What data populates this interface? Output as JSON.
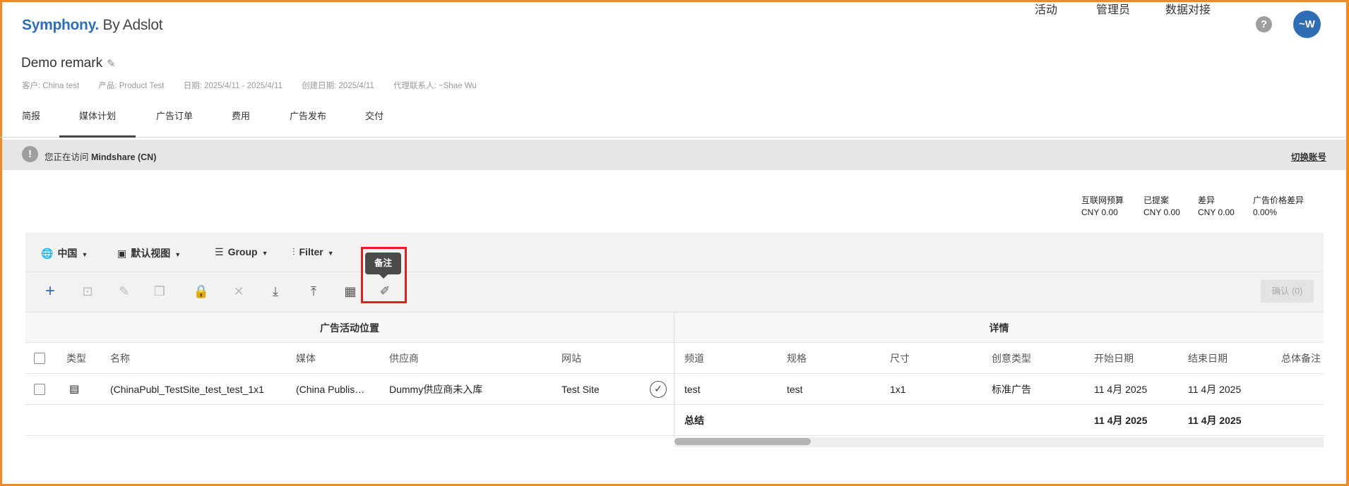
{
  "header": {
    "logo_brand": "Symphony.",
    "logo_suffix": "By Adslot",
    "nav": [
      "活动",
      "管理员",
      "数据对接"
    ],
    "help": "?",
    "avatar": "~W"
  },
  "campaign": {
    "title": "Demo remark",
    "meta": {
      "client": "客户: China test",
      "product": "产品: Product Test",
      "dates": "日期: 2025/4/11 - 2025/4/11",
      "created": "创建日期: 2025/4/11",
      "agency_contact": "代理联系人: ~Shae Wu"
    }
  },
  "tabs": [
    "简报",
    "媒体计划",
    "广告订单",
    "费用",
    "广告发布",
    "交付"
  ],
  "banner": {
    "prefix": "您正在访问",
    "account": "Mindshare (CN)",
    "switch_label": "切换账号"
  },
  "budget": [
    {
      "label": "互联网预算",
      "value": "CNY 0.00"
    },
    {
      "label": "已提案",
      "value": "CNY 0.00"
    },
    {
      "label": "差异",
      "value": "CNY 0.00"
    },
    {
      "label": "广告价格差异",
      "value": "0.00%"
    }
  ],
  "toolbar": {
    "country": "中国",
    "view": "默认视图",
    "group": "Group",
    "filter": "Filter",
    "tooltip": "备注",
    "confirm": "确认 (0)"
  },
  "table": {
    "group_left": "广告活动位置",
    "group_right": "详情",
    "columns": [
      "类型",
      "名称",
      "媒体",
      "供应商",
      "网站",
      "频道",
      "规格",
      "尺寸",
      "创意类型",
      "开始日期",
      "结束日期",
      "总体备注"
    ],
    "row": {
      "name": "(ChinaPubl_TestSite_test_test_1x1",
      "media": "(China Publis…",
      "vendor": "Dummy供应商未入库",
      "site": "Test Site",
      "channel": "test",
      "spec": "test",
      "size": "1x1",
      "creative_type": "标准广告",
      "start": "11 4月 2025",
      "end": "11 4月 2025"
    },
    "summary": {
      "label": "总结",
      "start": "11 4月 2025",
      "end": "11 4月 2025"
    }
  }
}
